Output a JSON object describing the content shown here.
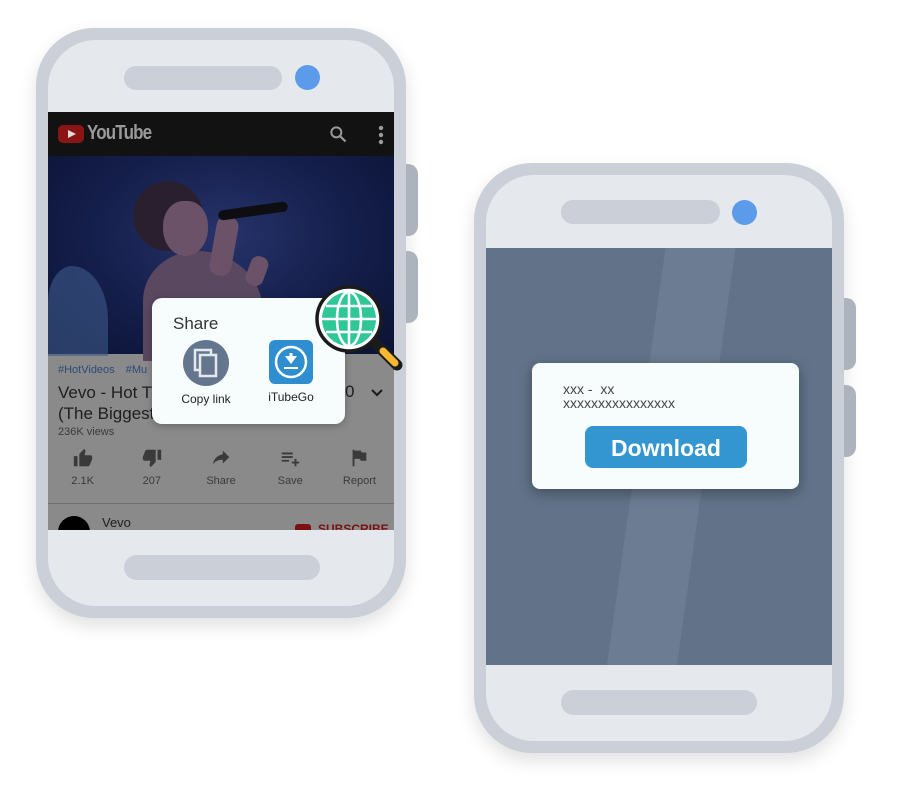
{
  "phone_left": {
    "app": {
      "name": "YouTube",
      "icons": [
        "youtube-logo-icon",
        "search-icon",
        "more-vert-icon"
      ]
    },
    "video": {
      "tags": [
        "#HotVideos",
        "#Mu"
      ],
      "title_line1": "Vevo - Hot Th",
      "title_line2": "(The Biggest",
      "title_tail": "0",
      "views": "236K views"
    },
    "actions": [
      {
        "icon": "thumbs-up-icon",
        "label": "2.1K"
      },
      {
        "icon": "thumbs-down-icon",
        "label": "207"
      },
      {
        "icon": "share-icon",
        "label": "Share"
      },
      {
        "icon": "playlist-add-icon",
        "label": "Save"
      },
      {
        "icon": "flag-icon",
        "label": "Report"
      }
    ],
    "channel": {
      "name": "Vevo",
      "subscribe_label": "SUBSCRIBE"
    },
    "share_sheet": {
      "title": "Share",
      "options": [
        {
          "icon": "copy-icon",
          "label": "Copy link"
        },
        {
          "icon": "itubego-download-icon",
          "label": "iTubeGo"
        }
      ]
    }
  },
  "phone_right": {
    "dialog": {
      "line1": "xxx -  xx",
      "line2": "xxxxxxxxxxxxxxxx",
      "button_label": "Download"
    }
  },
  "colors": {
    "phone_frame": "#cbd0d8",
    "phone_face": "#e5e8ed",
    "camera": "#5b9bea",
    "download_button": "#3396d1",
    "itubego_icon": "#2f8ecf",
    "globe": "#2ec795",
    "screen_right": "#627389"
  }
}
